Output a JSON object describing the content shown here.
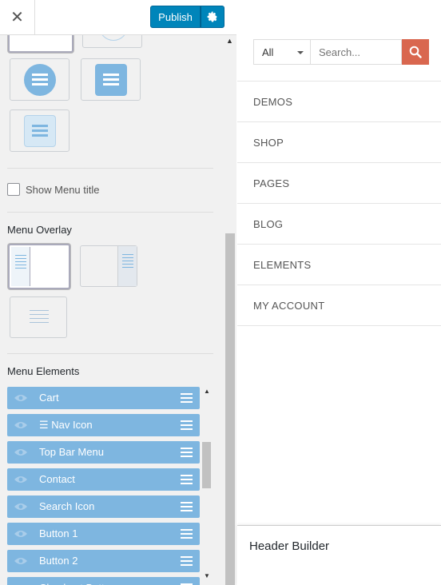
{
  "topbar": {
    "close_glyph": "✕",
    "publish_label": "Publish",
    "settings_icon": "gear-icon"
  },
  "panel": {
    "show_menu_title_label": "Show Menu title",
    "menu_overlay_title": "Menu Overlay",
    "menu_elements_title": "Menu Elements",
    "menu_elements": [
      {
        "label": "Cart"
      },
      {
        "label": "☰ Nav Icon"
      },
      {
        "label": "Top Bar Menu"
      },
      {
        "label": "Contact"
      },
      {
        "label": "Search Icon"
      },
      {
        "label": "Button 1"
      },
      {
        "label": "Button 2"
      },
      {
        "label": "Checkout Button"
      }
    ]
  },
  "preview": {
    "category_select_value": "All",
    "search_placeholder": "Search...",
    "nav_items": [
      "DEMOS",
      "SHOP",
      "PAGES",
      "BLOG",
      "ELEMENTS",
      "MY ACCOUNT"
    ],
    "header_builder_title": "Header Builder"
  },
  "colors": {
    "accent": "#0085ba",
    "element_blue": "#7eb6e0",
    "search_button": "#d9674f"
  }
}
